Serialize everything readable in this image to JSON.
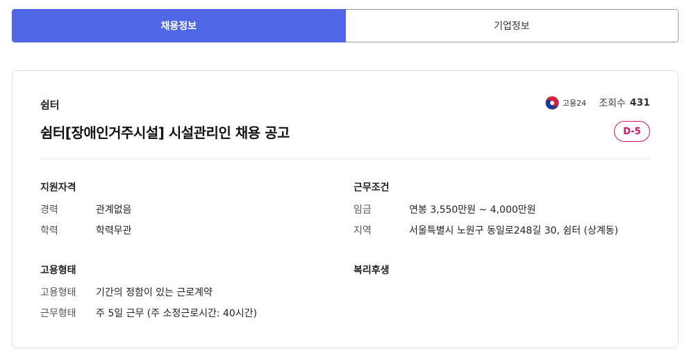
{
  "tabs": [
    {
      "label": "채용정보",
      "active": true
    },
    {
      "label": "기업정보",
      "active": false
    }
  ],
  "job": {
    "company": "쉼터",
    "title": "쉼터[장애인거주시설] 시설관리인 채용 공고",
    "source": "고용24",
    "views_label": "조회수",
    "views_count": "431",
    "dday": "D-5"
  },
  "sections": {
    "qualification": {
      "title": "지원자격",
      "rows": [
        {
          "key": "경력",
          "value": "관계없음"
        },
        {
          "key": "학력",
          "value": "학력무관"
        }
      ]
    },
    "conditions": {
      "title": "근무조건",
      "rows": [
        {
          "key": "임금",
          "value": "연봉 3,550만원 ~ 4,000만원"
        },
        {
          "key": "지역",
          "value": "서울특별시 노원구 동일로248길 30, 쉼터 (상계동)"
        }
      ]
    },
    "employment": {
      "title": "고용형태",
      "rows": [
        {
          "key": "고용형태",
          "value": "기간의 정함이 있는 근로계약"
        },
        {
          "key": "근무형태",
          "value": "주 5일 근무 (주 소정근로시간: 40시간)"
        }
      ]
    },
    "benefits": {
      "title": "복리후생",
      "rows": []
    }
  },
  "colors": {
    "accent": "#4f67e5",
    "dday": "#d4145a"
  }
}
